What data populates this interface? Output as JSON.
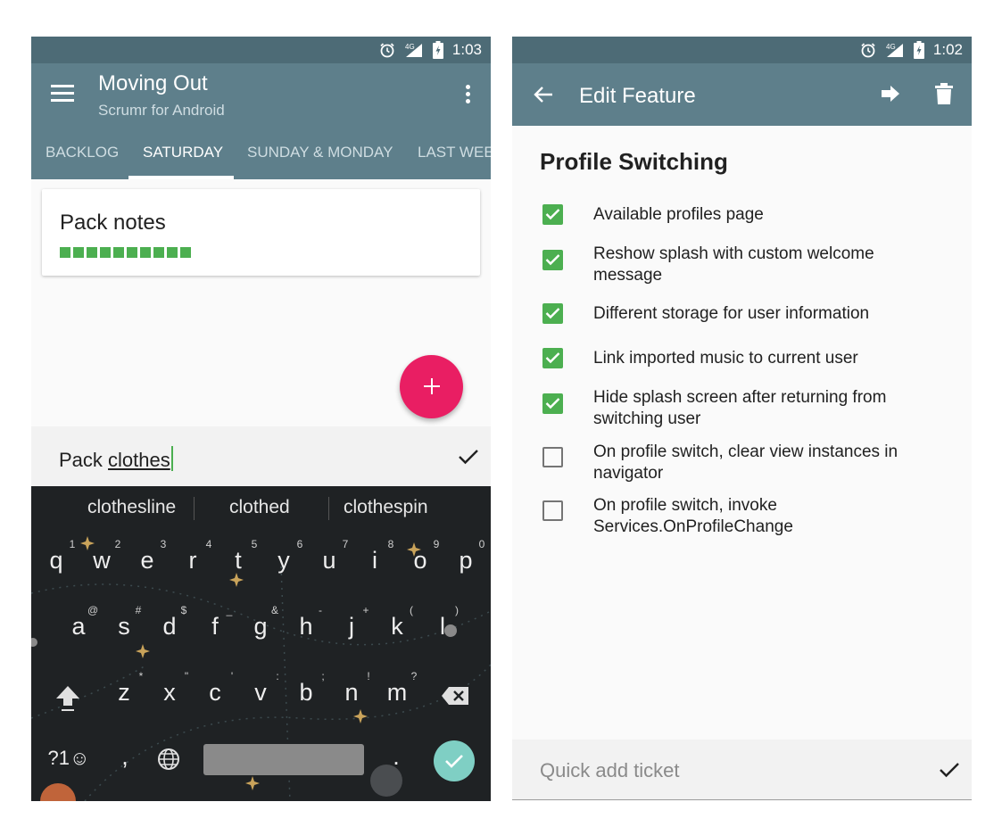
{
  "left_screen": {
    "status_bar": {
      "network": "4G",
      "time": "1:03",
      "icons": [
        "alarm-icon",
        "signal-icon",
        "battery-charging-icon"
      ]
    },
    "app_bar": {
      "title": "Moving Out",
      "subtitle": "Scrumr for Android",
      "icons": [
        "menu-icon",
        "overflow-menu-icon"
      ]
    },
    "tabs": [
      {
        "label": "BACKLOG",
        "active": false
      },
      {
        "label": "SATURDAY",
        "active": true
      },
      {
        "label": "SUNDAY & MONDAY",
        "active": false
      },
      {
        "label": "LAST WEE",
        "active": false
      }
    ],
    "card": {
      "title": "Pack notes",
      "progress_segments_filled": 10,
      "progress_color": "#4caf50"
    },
    "fab": {
      "icon": "plus-icon",
      "color": "#e91e63"
    },
    "input": {
      "prefix": "Pack ",
      "current_word": "clothes",
      "confirm_icon": "check-icon"
    },
    "keyboard": {
      "suggestions": [
        "clothesline",
        "clothed",
        "clothespin"
      ],
      "row1": {
        "keys": [
          "q",
          "w",
          "e",
          "r",
          "t",
          "y",
          "u",
          "i",
          "o",
          "p"
        ],
        "hints": [
          "1",
          "2",
          "3",
          "4",
          "5",
          "6",
          "7",
          "8",
          "9",
          "0"
        ]
      },
      "row2": {
        "keys": [
          "a",
          "s",
          "d",
          "f",
          "g",
          "h",
          "j",
          "k",
          "l"
        ],
        "hints": [
          "@",
          "#",
          "$",
          "_",
          "&",
          "-",
          "+",
          "(",
          ")"
        ]
      },
      "row3": {
        "keys": [
          "z",
          "x",
          "c",
          "v",
          "b",
          "n",
          "m"
        ],
        "hints": [
          "*",
          "\"",
          "'",
          ":",
          ";",
          "!",
          "?"
        ]
      },
      "bottom": {
        "symbols_label": "?1☺",
        "comma": ",",
        "period": "."
      },
      "icons": [
        "shift-icon",
        "backspace-icon",
        "globe-icon",
        "enter-check-icon"
      ],
      "accent_color": "#7fcfc4"
    }
  },
  "right_screen": {
    "status_bar": {
      "network": "4G",
      "time": "1:02",
      "icons": [
        "alarm-icon",
        "signal-icon",
        "battery-charging-icon"
      ]
    },
    "app_bar": {
      "title": "Edit Feature",
      "icons": [
        "back-arrow-icon",
        "forward-arrow-icon",
        "trash-icon"
      ]
    },
    "feature_title": "Profile Switching",
    "checklist": [
      {
        "label": "Available profiles page",
        "checked": true
      },
      {
        "label": "Reshow splash with custom welcome message",
        "checked": true
      },
      {
        "label": "Different storage for user information",
        "checked": true
      },
      {
        "label": "Link imported music to current user",
        "checked": true
      },
      {
        "label": "Hide splash screen after returning from switching user",
        "checked": true
      },
      {
        "label": "On profile switch, clear view instances in navigator",
        "checked": false
      },
      {
        "label": "On profile switch, invoke Services.OnProfileChange",
        "checked": false
      }
    ],
    "quick_add": {
      "placeholder": "Quick add ticket",
      "confirm_icon": "check-icon"
    },
    "check_color": "#4caf50",
    "appbar_color": "#5e7f8b"
  }
}
